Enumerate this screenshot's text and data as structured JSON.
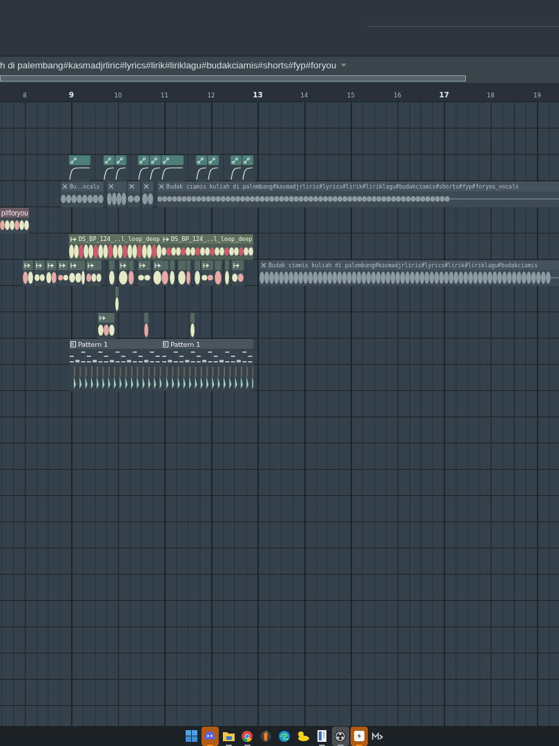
{
  "title": "h di palembang#kasmadjrliric#lyrics#lirik#liriklagu#budakciamis#shorts#fyp#foryou",
  "ruler": [
    {
      "label": "8",
      "major": false
    },
    {
      "label": "9",
      "major": true
    },
    {
      "label": "10",
      "major": false
    },
    {
      "label": "11",
      "major": false
    },
    {
      "label": "12",
      "major": false
    },
    {
      "label": "13",
      "major": true
    },
    {
      "label": "14",
      "major": false
    },
    {
      "label": "15",
      "major": false
    },
    {
      "label": "16",
      "major": false
    },
    {
      "label": "17",
      "major": true
    },
    {
      "label": "18",
      "major": false
    },
    {
      "label": "19",
      "major": false
    }
  ],
  "clips": [
    {
      "kind": "automation"
    },
    {
      "kind": "automation"
    },
    {
      "kind": "automation"
    },
    {
      "kind": "automation"
    },
    {
      "kind": "automation"
    },
    {
      "kind": "automation"
    },
    {
      "kind": "automation"
    },
    {
      "kind": "automation"
    },
    {
      "kind": "automation"
    },
    {
      "kind": "automation"
    },
    {
      "kind": "vocal",
      "label": "Bu..ocals"
    },
    {
      "kind": "vocal"
    },
    {
      "kind": "vocal"
    },
    {
      "kind": "vocal"
    },
    {
      "kind": "vocal",
      "label": "Budak ciamis kuliah di palembang#kasmadjrliric#lyrics#lirik#liriklagu#budakciamis#shorts#fyp#foryou_vocals"
    },
    {
      "kind": "sample",
      "label": "p#foryou"
    },
    {
      "kind": "loop",
      "label": "DS_BP_124_..l_loop_deep"
    },
    {
      "kind": "loop",
      "label": "DS_BP_124_..l_loop_deep"
    },
    {
      "kind": "chop"
    },
    {
      "kind": "chop"
    },
    {
      "kind": "chop"
    },
    {
      "kind": "chop"
    },
    {
      "kind": "chop"
    },
    {
      "kind": "chop"
    },
    {
      "kind": "chop"
    },
    {
      "kind": "chop"
    },
    {
      "kind": "chop"
    },
    {
      "kind": "chop"
    },
    {
      "kind": "chop"
    },
    {
      "kind": "chop"
    },
    {
      "kind": "chop"
    },
    {
      "kind": "chop"
    },
    {
      "kind": "chop"
    },
    {
      "kind": "chop"
    },
    {
      "kind": "chop"
    },
    {
      "kind": "chop"
    },
    {
      "kind": "chop"
    },
    {
      "kind": "chop"
    },
    {
      "kind": "chop"
    },
    {
      "kind": "vocal",
      "label": "Budak ciamis kuliah di palembang#kasmadjrliric#lyrics#lirik#liriklagu#budakciamis"
    },
    {
      "kind": "chop"
    },
    {
      "kind": "chop"
    },
    {
      "kind": "chop"
    },
    {
      "kind": "chop"
    },
    {
      "kind": "pattern",
      "label": "Pattern 1"
    },
    {
      "kind": "pattern",
      "label": "Pattern 1"
    }
  ],
  "taskbar": [
    {
      "kind": "grid",
      "running": false,
      "selected": false,
      "flashing": false
    },
    {
      "kind": "controller",
      "running": true,
      "selected": false,
      "flashing": true
    },
    {
      "kind": "folder",
      "running": true,
      "selected": false,
      "flashing": false
    },
    {
      "kind": "ring",
      "running": true,
      "selected": false,
      "flashing": false
    },
    {
      "kind": "fruit",
      "running": false,
      "selected": false,
      "flashing": false
    },
    {
      "kind": "swirl",
      "running": false,
      "selected": false,
      "flashing": false
    },
    {
      "kind": "duck",
      "running": false,
      "selected": false,
      "flashing": false
    },
    {
      "kind": "document",
      "running": true,
      "selected": false,
      "flashing": false
    },
    {
      "kind": "aperture",
      "running": true,
      "selected": true,
      "flashing": false
    },
    {
      "kind": "tile",
      "running": true,
      "selected": false,
      "flashing": true
    },
    {
      "kind": "wave",
      "running": false,
      "selected": false,
      "flashing": false
    }
  ]
}
